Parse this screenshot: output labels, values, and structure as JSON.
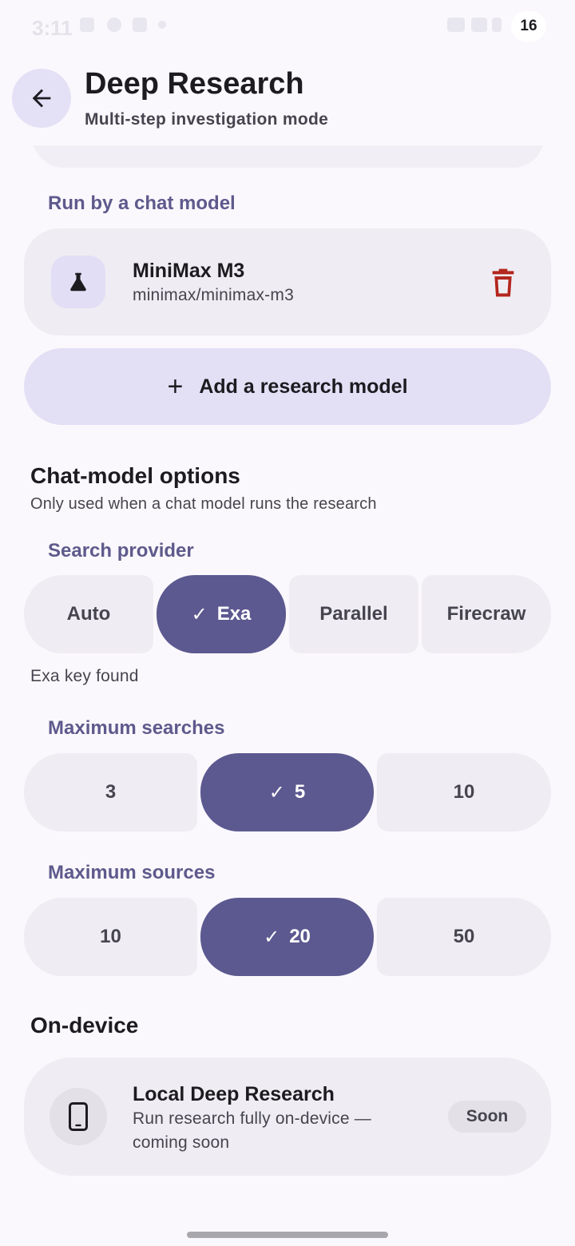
{
  "status_bar": {
    "time": "3:11",
    "battery": "16"
  },
  "header": {
    "title": "Deep Research",
    "subtitle": "Multi-step investigation mode",
    "back_icon": "arrow-back-icon"
  },
  "run_by_chat_model": {
    "label": "Run by a chat model",
    "model": {
      "name": "MiniMax M3",
      "id": "minimax/minimax-m3",
      "icon": "flask-icon",
      "delete_icon": "trash-icon"
    },
    "add_button_label": "Add a research model"
  },
  "chat_model_options": {
    "heading": "Chat-model options",
    "description": "Only used when a chat model runs the research",
    "search_provider": {
      "label": "Search provider",
      "options": [
        "Auto",
        "Exa",
        "Parallel",
        "Firecraw"
      ],
      "selected": "Exa",
      "helper": "Exa key found"
    },
    "max_searches": {
      "label": "Maximum searches",
      "options": [
        "3",
        "5",
        "10"
      ],
      "selected": "5"
    },
    "max_sources": {
      "label": "Maximum sources",
      "options": [
        "10",
        "20",
        "50"
      ],
      "selected": "20"
    }
  },
  "on_device": {
    "heading": "On-device",
    "card": {
      "title": "Local Deep Research",
      "description": "Run research fully on-device — coming soon",
      "badge": "Soon",
      "icon": "phone-icon"
    }
  },
  "colors": {
    "accent": "#5c5990",
    "accent_container": "#e3dff5",
    "surface_container": "#efedf3",
    "delete": "#b3261e"
  }
}
